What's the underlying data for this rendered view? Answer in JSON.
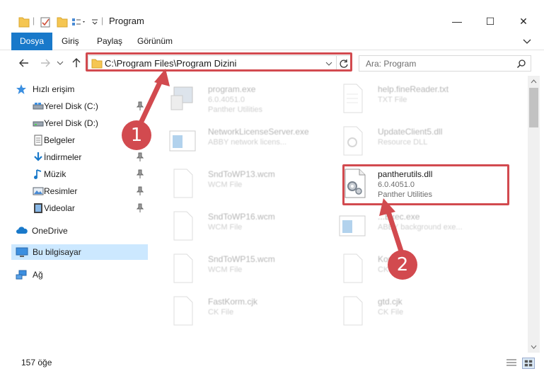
{
  "window": {
    "title": "Program",
    "minimize_glyph": "—",
    "maximize_glyph": "☐",
    "close_glyph": "✕"
  },
  "ribbon": {
    "tabs": [
      {
        "label": "Dosya",
        "active": true
      },
      {
        "label": "Giriş",
        "active": false
      },
      {
        "label": "Paylaş",
        "active": false
      },
      {
        "label": "Görünüm",
        "active": false
      }
    ]
  },
  "address": {
    "path": "C:\\Program Files\\Program Dizini",
    "search_placeholder": "Ara: Program"
  },
  "nav": {
    "items": [
      {
        "label": "Hızlı erişim",
        "icon": "star-icon",
        "pinned": false
      },
      {
        "label": "Yerel Disk (C:)",
        "icon": "drive-icon",
        "pinned": true
      },
      {
        "label": "Yerel Disk (D:)",
        "icon": "drive-icon",
        "pinned": false
      },
      {
        "label": "Belgeler",
        "icon": "documents-icon",
        "pinned": false
      },
      {
        "label": "İndirmeler",
        "icon": "download-icon",
        "pinned": true
      },
      {
        "label": "Müzik",
        "icon": "music-icon",
        "pinned": true
      },
      {
        "label": "Resimler",
        "icon": "pictures-icon",
        "pinned": true
      },
      {
        "label": "Videolar",
        "icon": "video-icon",
        "pinned": true
      },
      {
        "label": "OneDrive",
        "icon": "cloud-icon",
        "pinned": false
      },
      {
        "label": "Bu bilgisayar",
        "icon": "computer-icon",
        "pinned": false,
        "selected": true
      },
      {
        "label": "Ağ",
        "icon": "network-icon",
        "pinned": false
      }
    ]
  },
  "files": [
    {
      "name": "program.exe",
      "line1": "6.0.4051.0",
      "line2": "Panther Utilities",
      "icon": "exe-icon",
      "faded": true
    },
    {
      "name": "help.fineReader.txt",
      "line1": "TXT File",
      "line2": "",
      "icon": "text-file-icon",
      "faded": true
    },
    {
      "name": "NetworkLicenseServer.exe",
      "line1": "ABBY network licens...",
      "line2": "",
      "icon": "app-window-icon",
      "faded": true
    },
    {
      "name": "UpdateClient5.dll",
      "line1": "Resource DLL",
      "line2": "",
      "icon": "dll-icon",
      "faded": true
    },
    {
      "name": "SndToWP13.wcm",
      "line1": "WCM File",
      "line2": "",
      "icon": "blank-file-icon",
      "faded": true
    },
    {
      "name": "pantherutils.dll",
      "line1": "6.0.4051.0",
      "line2": "Panther Utilities",
      "icon": "gear-file-icon",
      "faded": false
    },
    {
      "name": "SndToWP16.wcm",
      "line1": "WCM File",
      "line2": "",
      "icon": "blank-file-icon",
      "faded": true
    },
    {
      "name": "...Exec.exe",
      "line1": "ABBY background exe...",
      "line2": "",
      "icon": "app-window-icon",
      "faded": true
    },
    {
      "name": "SndToWP15.wcm",
      "line1": "WCM File",
      "line2": "",
      "icon": "blank-file-icon",
      "faded": true
    },
    {
      "name": "Kor...k",
      "line1": "CK...",
      "line2": "",
      "icon": "blank-file-icon",
      "faded": true
    },
    {
      "name": "FastKorm.cjk",
      "line1": "CK File",
      "line2": "",
      "icon": "blank-file-icon",
      "faded": true
    },
    {
      "name": "gtd.cjk",
      "line1": "CK File",
      "line2": "",
      "icon": "blank-file-icon",
      "faded": true
    }
  ],
  "status": {
    "item_count": "157 öğe"
  },
  "callouts": {
    "one": "1",
    "two": "2",
    "color": "#d24a4f"
  },
  "colors": {
    "accent": "#1979ca",
    "selection": "#cce8ff",
    "highlight": "#d24a4f"
  }
}
